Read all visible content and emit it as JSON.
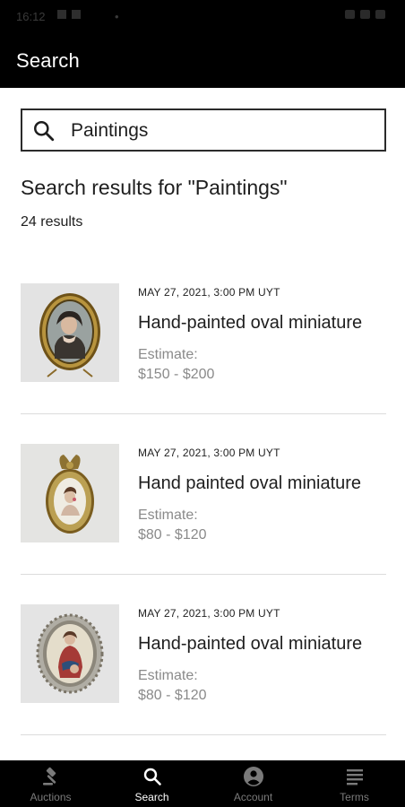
{
  "status_bar": {
    "time": "16:12",
    "dot": "•"
  },
  "app_bar": {
    "title": "Search"
  },
  "search": {
    "value": "Paintings",
    "icon": "search-icon"
  },
  "results": {
    "heading": "Search results for \"Paintings\"",
    "count": "24 results",
    "items": [
      {
        "date": "MAY 27, 2021, 3:00 PM UYT",
        "name": "Hand-painted oval miniature",
        "estimate_label": "Estimate:",
        "estimate_range": "$150 - $200"
      },
      {
        "date": "MAY 27, 2021, 3:00 PM UYT",
        "name": "Hand painted oval miniature",
        "estimate_label": "Estimate:",
        "estimate_range": "$80 - $120"
      },
      {
        "date": "MAY 27, 2021, 3:00 PM UYT",
        "name": "Hand-painted oval miniature",
        "estimate_label": "Estimate:",
        "estimate_range": "$80 - $120"
      }
    ]
  },
  "bottom_nav": {
    "items": [
      {
        "label": "Auctions",
        "icon": "gavel-icon"
      },
      {
        "label": "Search",
        "icon": "search-icon"
      },
      {
        "label": "Account",
        "icon": "account-icon"
      },
      {
        "label": "Terms",
        "icon": "document-icon"
      }
    ],
    "active": "Search"
  },
  "colors": {
    "bar_background": "#000000",
    "nav_active": "#ffffff",
    "nav_inactive": "#7a7a7a",
    "muted_text": "#8a8a8a"
  }
}
